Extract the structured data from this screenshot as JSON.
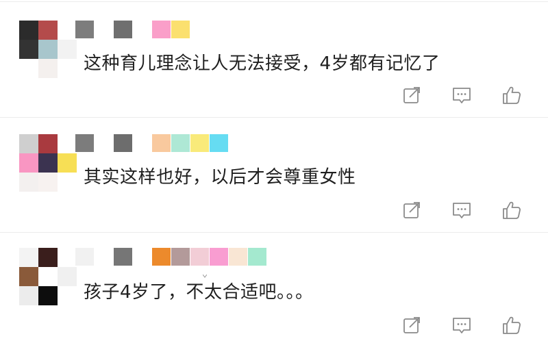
{
  "comments": [
    {
      "text": "这种育儿理念让人无法接受，4岁都有记忆了",
      "avatar_colors": [
        "#2b2b2b",
        "#b44b4b",
        "#ffffff",
        "#333333",
        "#a8c6cc",
        "#f2f2f2",
        "#ffffff",
        "#f4f0ee",
        "#ffffff"
      ],
      "name_colors": [
        "#7d7d7d",
        "#6f6f6f"
      ],
      "badge_colors": [
        "#fa9fc9",
        "#fbe06f"
      ]
    },
    {
      "text": "其实这样也好，以后才会尊重女性",
      "avatar_colors": [
        "#cfcfcf",
        "#a93a3f",
        "#ffffff",
        "#f996c2",
        "#3b3350",
        "#f7df55",
        "#f3f0ef",
        "#f7f2f0",
        "#ffffff"
      ],
      "name_colors": [
        "#7c7c7c",
        "#6d6d6d"
      ],
      "badge_colors": [
        "#f9c99e",
        "#aee8d5",
        "#f9ea7a",
        "#66dcf2"
      ]
    },
    {
      "text": "孩子4岁了，不太合适吧。。。",
      "avatar_colors": [
        "#f3f3f3",
        "#3a1e1c",
        "#ffffff",
        "#8a5a3a",
        "#ffffff",
        "#f0f0f0",
        "#ececec",
        "#0d0d0d",
        "#ffffff"
      ],
      "name_colors": [
        "#f1f1f1",
        "#767676"
      ],
      "badge_colors": [
        "#ec8a2c",
        "#b39a9a",
        "#f2cdd6",
        "#f99dd1",
        "#f9e6d4",
        "#a4e9cf"
      ]
    }
  ],
  "actions": {
    "share_icon": "share-icon",
    "reply_icon": "comment-icon",
    "like_icon": "thumbs-up-icon"
  },
  "colors": {
    "text": "#1f1f1f",
    "icon": "#8a8a8a",
    "divider": "#ececec"
  }
}
